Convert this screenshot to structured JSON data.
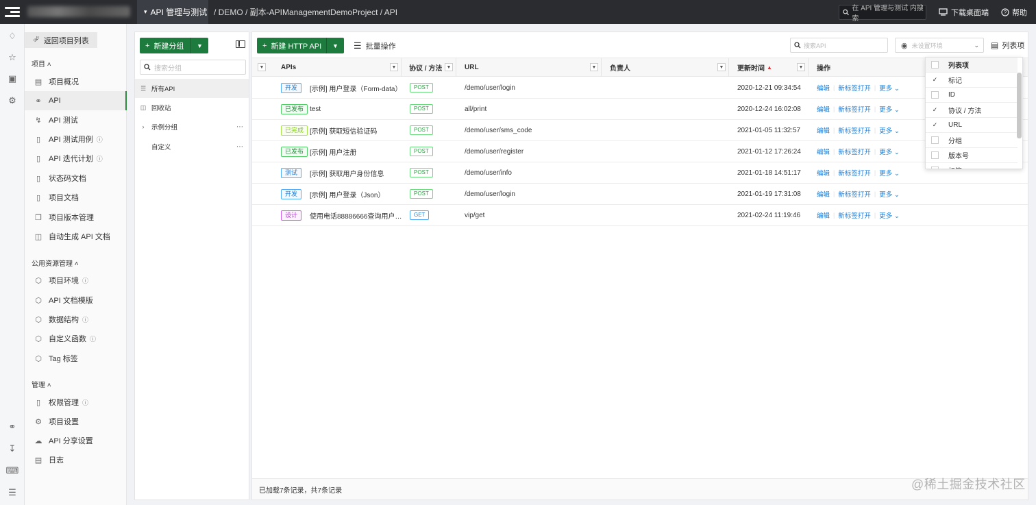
{
  "topbar": {
    "module_tab": "API 管理与测试",
    "breadcrumb": "/ DEMO / 副本-APIManagementDemoProject / API",
    "search_placeholder": "在 API 管理与测试 内搜索",
    "download_label": "下载桌面端",
    "help_label": "帮助"
  },
  "sidebar": {
    "back_label": "返回项目列表",
    "sections": {
      "project": "项目",
      "public": "公用资源管理",
      "manage": "管理"
    },
    "items": [
      {
        "label": "项目概况",
        "icon": "overview-icon"
      },
      {
        "label": "API",
        "icon": "api-link-icon",
        "active": true
      },
      {
        "label": "API 测试",
        "icon": "flash-icon"
      },
      {
        "label": "API 测试用例",
        "icon": "doc-icon"
      },
      {
        "label": "API 迭代计划",
        "icon": "doc-icon"
      },
      {
        "label": "状态码文档",
        "icon": "doc-icon"
      },
      {
        "label": "项目文档",
        "icon": "doc-icon"
      },
      {
        "label": "项目版本管理",
        "icon": "version-icon"
      },
      {
        "label": "自动生成 API 文档",
        "icon": "auto-icon"
      },
      {
        "label": "项目环境",
        "icon": "cube-icon"
      },
      {
        "label": "API 文档模版",
        "icon": "cube-icon"
      },
      {
        "label": "数据结构",
        "icon": "cube-icon"
      },
      {
        "label": "自定义函数",
        "icon": "cube-icon"
      },
      {
        "label": "Tag 标签",
        "icon": "cube-icon"
      },
      {
        "label": "权限管理",
        "icon": "doc-icon"
      },
      {
        "label": "项目设置",
        "icon": "gear-icon"
      },
      {
        "label": "API 分享设置",
        "icon": "cloud-icon"
      },
      {
        "label": "日志",
        "icon": "log-icon"
      }
    ]
  },
  "groups": {
    "new_label": "新建分组",
    "search_placeholder": "搜索分组",
    "items": [
      {
        "label": "所有API"
      },
      {
        "label": "回收站"
      },
      {
        "label": "示例分组"
      },
      {
        "label": "自定义"
      }
    ]
  },
  "main": {
    "new_api_label": "新建 HTTP API",
    "batch_label": "批量操作",
    "search_placeholder": "搜索API",
    "env_placeholder": "未设置环境",
    "columns_label": "列表项",
    "columns": {
      "apis": "APIs",
      "protocol": "协议 / 方法",
      "url": "URL",
      "owner": "负责人",
      "updated": "更新时间",
      "ops": "操作"
    },
    "rows": [
      {
        "status": "开发",
        "status_type": "dev",
        "name": "[示例] 用户登录（Form-data）",
        "method": "POST",
        "url": "/demo/user/login",
        "owner": "",
        "updated": "2020-12-21 09:34:54"
      },
      {
        "status": "已发布",
        "status_type": "pub",
        "name": "test",
        "method": "POST",
        "url": "all/print",
        "owner": "",
        "updated": "2020-12-24 16:02:08"
      },
      {
        "status": "已完成",
        "status_type": "done",
        "name": "[示例] 获取短信验证码",
        "method": "POST",
        "url": "/demo/user/sms_code",
        "owner": "",
        "updated": "2021-01-05 11:32:57"
      },
      {
        "status": "已发布",
        "status_type": "pub",
        "name": "[示例] 用户注册",
        "method": "POST",
        "url": "/demo/user/register",
        "owner": "",
        "updated": "2021-01-12 17:26:24"
      },
      {
        "status": "测试",
        "status_type": "test",
        "name": "[示例] 获取用户身份信息",
        "method": "POST",
        "url": "/demo/user/info",
        "owner": "",
        "updated": "2021-01-18 14:51:17"
      },
      {
        "status": "开发",
        "status_type": "dev",
        "name": "[示例] 用户登录（Json）",
        "method": "POST",
        "url": "/demo/user/login",
        "owner": "",
        "updated": "2021-01-19 17:31:08"
      },
      {
        "status": "设计",
        "status_type": "design",
        "name": "使用电话88886666查询用户…",
        "method": "GET",
        "url": "vip/get",
        "owner": "",
        "updated": "2021-02-24 11:19:46"
      }
    ],
    "op_edit": "编辑",
    "op_newtab": "新标签打开",
    "op_more": "更多",
    "footer": "已加载7条记录，共7条记录"
  },
  "column_panel": {
    "title": "列表项",
    "options": [
      {
        "label": "标记",
        "checked": true
      },
      {
        "label": "ID",
        "checked": false
      },
      {
        "label": "协议 / 方法",
        "checked": true
      },
      {
        "label": "URL",
        "checked": true
      },
      {
        "label": "分组",
        "checked": false
      },
      {
        "label": "版本号",
        "checked": false
      },
      {
        "label": "标签",
        "checked": false
      }
    ]
  },
  "watermark": "@稀土掘金技术社区",
  "colors": {
    "brand_green": "#1e7b3e",
    "topbar": "#2a2c30",
    "link_blue": "#1c7ed6"
  }
}
